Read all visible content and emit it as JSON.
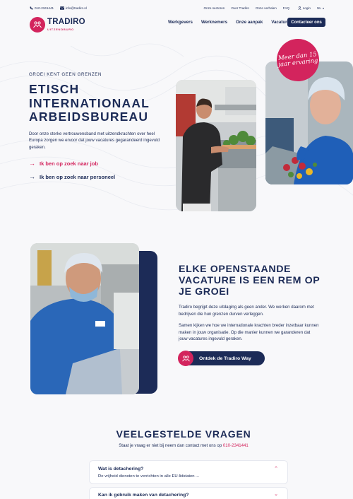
{
  "topbar": {
    "phone": "010-2341441",
    "email": "info@tradiro.nl",
    "links": [
      "Onze sectoren",
      "Over Tradiro",
      "Onze verhalen",
      "FAQ"
    ],
    "login": "Login",
    "language": "NL"
  },
  "header": {
    "logo_name": "TRADIRO",
    "logo_sub": "UITZENDBURO",
    "nav": [
      "Werkgevers",
      "Werknemers",
      "Onze aanpak",
      "Vacatures"
    ],
    "cta": "Contacteer ons"
  },
  "hero": {
    "eyebrow": "GROEI KENT GEEN GRENZEN",
    "title": "ETISCH INTERNATIONAAL ARBEIDSBUREAU",
    "text": "Door onze sterke vertrouwensband met uitzendkrachten over heel Europa zorgen we ervoor dat jouw vacatures gegarandeerd ingevuld geraken.",
    "link_job": "Ik ben op zoek naar job",
    "link_staff": "Ik ben op zoek naar personeel",
    "badge": "Meer dan 15 jaar ervaring"
  },
  "section2": {
    "title": "ELKE OPENSTAANDE VACATURE IS EEN REM OP JE GROEI",
    "p1": "Tradiro begrijpt deze uitdaging als geen ander. We werken daarom met bedrijven die hun grenzen durven verleggen.",
    "p2": "Samen kijken we hoe we internationale krachten breder inzetbaar kunnen maken in jouw organisatie. Op die manier kunnen we garanderen dat jouw vacatures ingevuld geraken.",
    "button": "Ontdek de Tradiro Way"
  },
  "faq": {
    "title": "VEELGESTELDE VRAGEN",
    "subtitle": "Staat je vraag er niet bij neem dan contact met ons op",
    "phone": "010-2341441",
    "items": [
      {
        "q": "Wat is detachering?",
        "a": "De vrijheid diensten te verrichten in alle EU-lidstaten ..."
      },
      {
        "q": "Kan ik gebruik maken van detachering?",
        "a": ""
      }
    ]
  },
  "colors": {
    "navy": "#1c2b57",
    "brand_pink": "#d3245d",
    "background": "#f8f8fa"
  }
}
